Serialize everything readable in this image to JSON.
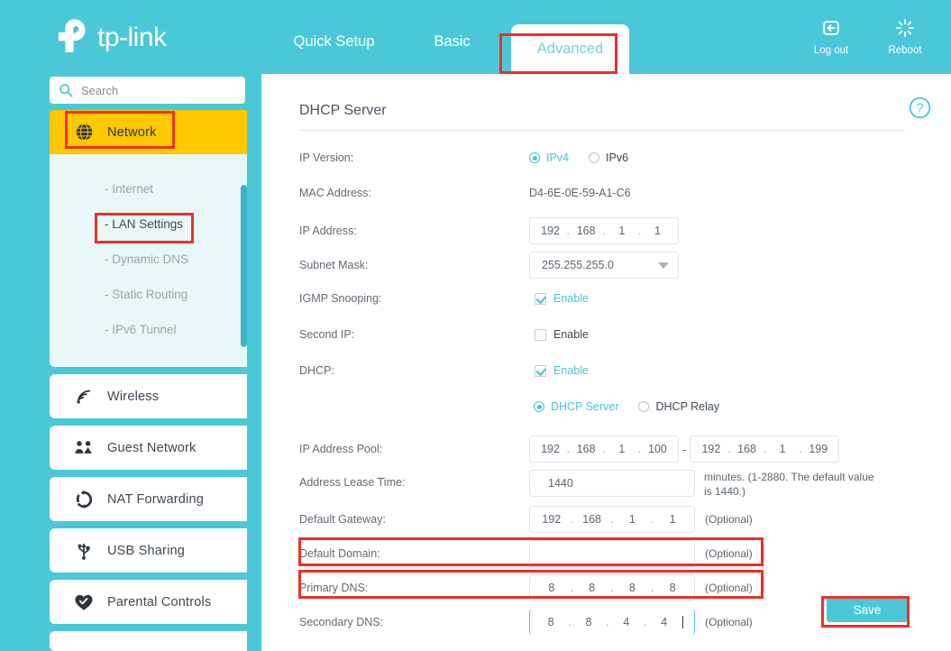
{
  "brand": {
    "name": "tp-link",
    "logo_icon": "tp-link-logo"
  },
  "search": {
    "placeholder": "Search",
    "value": "",
    "icon": "search-icon"
  },
  "header": {
    "tabs": [
      {
        "label": "Quick Setup",
        "active": false
      },
      {
        "label": "Basic",
        "active": false
      },
      {
        "label": "Advanced",
        "active": true
      }
    ],
    "actions": [
      {
        "label": "Log out",
        "icon": "logout-icon"
      },
      {
        "label": "Reboot",
        "icon": "reboot-icon"
      }
    ]
  },
  "sidebar": {
    "items": [
      {
        "label": "Network",
        "icon": "globe-icon",
        "active": true
      },
      {
        "label": "Wireless",
        "icon": "wifi-icon",
        "active": false
      },
      {
        "label": "Guest Network",
        "icon": "users-icon",
        "active": false
      },
      {
        "label": "NAT Forwarding",
        "icon": "refresh-icon",
        "active": false
      },
      {
        "label": "USB Sharing",
        "icon": "usb-icon",
        "active": false
      },
      {
        "label": "Parental Controls",
        "icon": "heart-icon",
        "active": false
      }
    ],
    "submenu": [
      {
        "label": "- Internet",
        "selected": false
      },
      {
        "label": "- LAN Settings",
        "selected": true
      },
      {
        "label": "- Dynamic DNS",
        "selected": false
      },
      {
        "label": "- Static Routing",
        "selected": false
      },
      {
        "label": "- IPv6 Tunnel",
        "selected": false
      }
    ]
  },
  "panel": {
    "title": "DHCP Server",
    "help_icon": "help-circle-icon",
    "save_label": "Save",
    "rows": {
      "ip_version": {
        "label": "IP Version:",
        "options": [
          {
            "label": "IPv4",
            "selected": true
          },
          {
            "label": "IPv6",
            "selected": false
          }
        ]
      },
      "mac_address": {
        "label": "MAC Address:",
        "value": "D4-6E-0E-59-A1-C6"
      },
      "ip_address": {
        "label": "IP Address:",
        "octets": [
          "192",
          "168",
          "1",
          "1"
        ]
      },
      "subnet_mask": {
        "label": "Subnet Mask:",
        "value": "255.255.255.0"
      },
      "igmp_snooping": {
        "label": "IGMP Snooping:",
        "checkbox_label": "Enable",
        "checked": true
      },
      "second_ip": {
        "label": "Second IP:",
        "checkbox_label": "Enable",
        "checked": false
      },
      "dhcp": {
        "label": "DHCP:",
        "checkbox_label": "Enable",
        "checked": true
      },
      "dhcp_mode": {
        "options": [
          {
            "label": "DHCP Server",
            "selected": true
          },
          {
            "label": "DHCP Relay",
            "selected": false
          }
        ]
      },
      "ip_address_pool": {
        "label": "IP Address Pool:",
        "start_octets": [
          "192",
          "168",
          "1",
          "100"
        ],
        "separator": "-",
        "end_octets": [
          "192",
          "168",
          "1",
          "199"
        ]
      },
      "address_lease_time": {
        "label": "Address Lease Time:",
        "value": "1440",
        "hint": "minutes. (1-2880. The default value is 1440.)"
      },
      "default_gateway": {
        "label": "Default Gateway:",
        "octets": [
          "192",
          "168",
          "1",
          "1"
        ],
        "suffix": "(Optional)"
      },
      "default_domain": {
        "label": "Default Domain:",
        "value": "",
        "suffix": "(Optional)"
      },
      "primary_dns": {
        "label": "Primary DNS:",
        "octets": [
          "8",
          "8",
          "8",
          "8"
        ],
        "suffix": "(Optional)"
      },
      "secondary_dns": {
        "label": "Secondary DNS:",
        "octets": [
          "8",
          "8",
          "4",
          "4"
        ],
        "suffix": "(Optional)",
        "focused": true
      }
    }
  },
  "colors": {
    "teal": "#4ac8d8",
    "yellow": "#ffc800",
    "submenu_bg": "#e8f7f8",
    "annotation_red": "#ef3024",
    "accent_text": "#46c4d4"
  }
}
